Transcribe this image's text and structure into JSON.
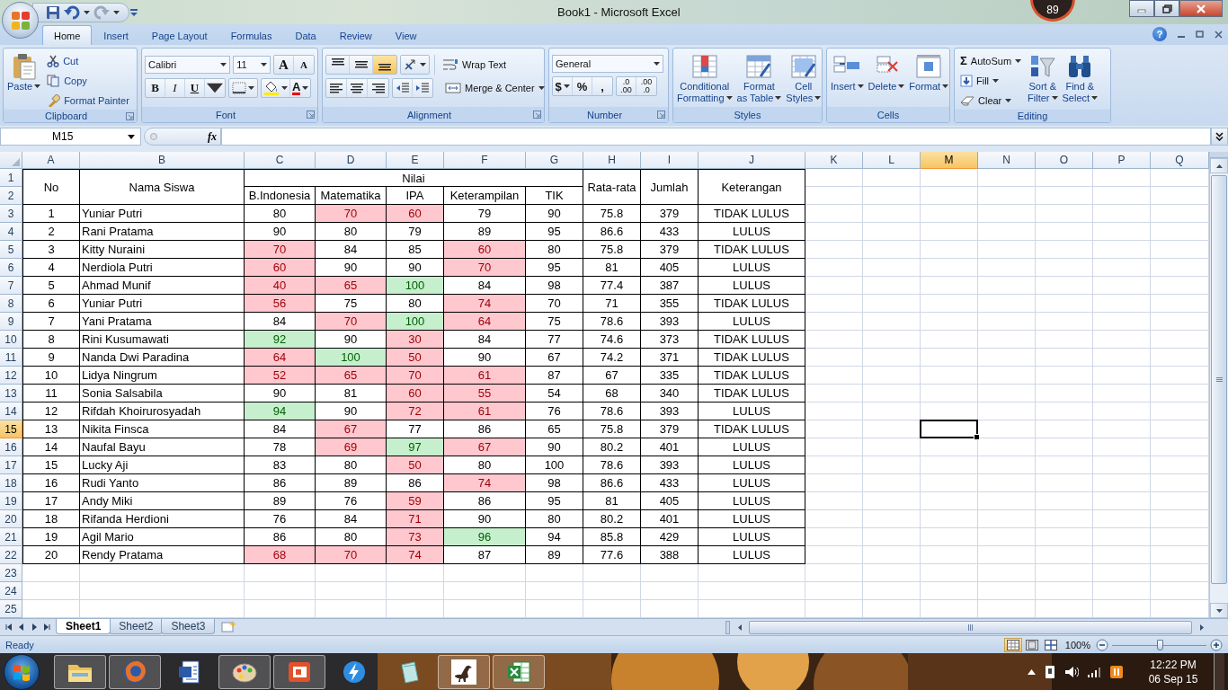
{
  "window": {
    "title": "Book1 - Microsoft Excel",
    "gadget_reading": "89",
    "help": "?"
  },
  "ribbon": {
    "tabs": [
      {
        "label": "Home",
        "selected": true
      },
      {
        "label": "Insert",
        "selected": false
      },
      {
        "label": "Page Layout",
        "selected": false
      },
      {
        "label": "Formulas",
        "selected": false
      },
      {
        "label": "Data",
        "selected": false
      },
      {
        "label": "Review",
        "selected": false
      },
      {
        "label": "View",
        "selected": false
      }
    ],
    "clipboard": {
      "title": "Clipboard",
      "paste": "Paste",
      "cut": "Cut",
      "copy": "Copy",
      "format_painter": "Format Painter"
    },
    "font": {
      "title": "Font",
      "font_name": "Calibri",
      "font_size": "11",
      "grow": "A",
      "shrink": "A",
      "bold": "B",
      "italic": "I",
      "underline": "U",
      "font_color": "A"
    },
    "alignment": {
      "title": "Alignment",
      "vertical": [
        {
          "kind": "top",
          "selected": false
        },
        {
          "kind": "middle",
          "selected": false
        },
        {
          "kind": "bottom",
          "selected": true
        }
      ],
      "horizontal": [
        {
          "kind": "left",
          "selected": false
        },
        {
          "kind": "center",
          "selected": false
        },
        {
          "kind": "right",
          "selected": false
        }
      ],
      "wrap_text": "Wrap Text",
      "merge": "Merge & Center"
    },
    "number": {
      "title": "Number",
      "format": "General",
      "currency": "$",
      "percent": "%",
      "comma": ",",
      "increase_decimal": [
        ".0",
        ".00"
      ],
      "decrease_decimal": [
        ".00",
        ".0"
      ]
    },
    "styles": {
      "title": "Styles",
      "conditional": [
        "Conditional",
        "Formatting"
      ],
      "as_table": [
        "Format",
        "as Table"
      ],
      "cell_styles": [
        "Cell",
        "Styles"
      ]
    },
    "cells": {
      "title": "Cells",
      "insert": "Insert",
      "delete": "Delete",
      "format": "Format"
    },
    "editing": {
      "title": "Editing",
      "autosum_symbol": "Σ",
      "autosum": "AutoSum",
      "fill": "Fill",
      "clear": "Clear",
      "sort": [
        "Sort &",
        "Filter"
      ],
      "find": [
        "Find &",
        "Select"
      ]
    }
  },
  "formula_bar": {
    "name_box": "M15",
    "fx": "fx"
  },
  "sheet": {
    "column_headers": [
      {
        "label": "A",
        "selected": false
      },
      {
        "label": "B",
        "selected": false
      },
      {
        "label": "C",
        "selected": false
      },
      {
        "label": "D",
        "selected": false
      },
      {
        "label": "E",
        "selected": false
      },
      {
        "label": "F",
        "selected": false
      },
      {
        "label": "G",
        "selected": false
      },
      {
        "label": "H",
        "selected": false
      },
      {
        "label": "I",
        "selected": false
      },
      {
        "label": "J",
        "selected": false
      },
      {
        "label": "K",
        "selected": false
      },
      {
        "label": "L",
        "selected": false
      },
      {
        "label": "M",
        "selected": true
      },
      {
        "label": "N",
        "selected": false
      },
      {
        "label": "O",
        "selected": false
      },
      {
        "label": "P",
        "selected": false
      },
      {
        "label": "Q",
        "selected": false
      }
    ],
    "row_headers": [
      {
        "label": "1",
        "selected": false
      },
      {
        "label": "2",
        "selected": false
      },
      {
        "label": "3",
        "selected": false
      },
      {
        "label": "4",
        "selected": false
      },
      {
        "label": "5",
        "selected": false
      },
      {
        "label": "6",
        "selected": false
      },
      {
        "label": "7",
        "selected": false
      },
      {
        "label": "8",
        "selected": false
      },
      {
        "label": "9",
        "selected": false
      },
      {
        "label": "10",
        "selected": false
      },
      {
        "label": "11",
        "selected": false
      },
      {
        "label": "12",
        "selected": false
      },
      {
        "label": "13",
        "selected": false
      },
      {
        "label": "14",
        "selected": false
      },
      {
        "label": "15",
        "selected": true
      },
      {
        "label": "16",
        "selected": false
      },
      {
        "label": "17",
        "selected": false
      },
      {
        "label": "18",
        "selected": false
      },
      {
        "label": "19",
        "selected": false
      },
      {
        "label": "20",
        "selected": false
      },
      {
        "label": "21",
        "selected": false
      },
      {
        "label": "22",
        "selected": false
      },
      {
        "label": "23",
        "selected": false
      },
      {
        "label": "24",
        "selected": false
      },
      {
        "label": "25",
        "selected": false
      }
    ],
    "table": {
      "no": "No",
      "name": "Nama Siswa",
      "group": "Nilai",
      "subjects": [
        "B.Indonesia",
        "Matematika",
        "IPA",
        "Keterampilan",
        "TIK"
      ],
      "average": "Rata-rata",
      "total": "Jumlah",
      "result": "Keterangan"
    },
    "rows": [
      {
        "no": "1",
        "name": "Yuniar Putri",
        "scores": [
          {
            "value": "80",
            "color": "#ffffff"
          },
          {
            "value": "70",
            "color": "#ffc7ce"
          },
          {
            "value": "60",
            "color": "#ffc7ce"
          },
          {
            "value": "79",
            "color": "#ffffff"
          },
          {
            "value": "90",
            "color": "#ffffff"
          }
        ],
        "average": "75.8",
        "total": "379",
        "result": "TIDAK LULUS"
      },
      {
        "no": "2",
        "name": "Rani Pratama",
        "scores": [
          {
            "value": "90",
            "color": "#ffffff"
          },
          {
            "value": "80",
            "color": "#ffffff"
          },
          {
            "value": "79",
            "color": "#ffffff"
          },
          {
            "value": "89",
            "color": "#ffffff"
          },
          {
            "value": "95",
            "color": "#ffffff"
          }
        ],
        "average": "86.6",
        "total": "433",
        "result": "LULUS"
      },
      {
        "no": "3",
        "name": "Kitty Nuraini",
        "scores": [
          {
            "value": "70",
            "color": "#ffc7ce"
          },
          {
            "value": "84",
            "color": "#ffffff"
          },
          {
            "value": "85",
            "color": "#ffffff"
          },
          {
            "value": "60",
            "color": "#ffc7ce"
          },
          {
            "value": "80",
            "color": "#ffffff"
          }
        ],
        "average": "75.8",
        "total": "379",
        "result": "TIDAK LULUS"
      },
      {
        "no": "4",
        "name": "Nerdiola Putri",
        "scores": [
          {
            "value": "60",
            "color": "#ffc7ce"
          },
          {
            "value": "90",
            "color": "#ffffff"
          },
          {
            "value": "90",
            "color": "#ffffff"
          },
          {
            "value": "70",
            "color": "#ffc7ce"
          },
          {
            "value": "95",
            "color": "#ffffff"
          }
        ],
        "average": "81",
        "total": "405",
        "result": "LULUS"
      },
      {
        "no": "5",
        "name": "Ahmad Munif",
        "scores": [
          {
            "value": "40",
            "color": "#ffc7ce"
          },
          {
            "value": "65",
            "color": "#ffc7ce"
          },
          {
            "value": "100",
            "color": "#c6efce"
          },
          {
            "value": "84",
            "color": "#ffffff"
          },
          {
            "value": "98",
            "color": "#ffffff"
          }
        ],
        "average": "77.4",
        "total": "387",
        "result": "LULUS"
      },
      {
        "no": "6",
        "name": "Yuniar Putri",
        "scores": [
          {
            "value": "56",
            "color": "#ffc7ce"
          },
          {
            "value": "75",
            "color": "#ffffff"
          },
          {
            "value": "80",
            "color": "#ffffff"
          },
          {
            "value": "74",
            "color": "#ffc7ce"
          },
          {
            "value": "70",
            "color": "#ffffff"
          }
        ],
        "average": "71",
        "total": "355",
        "result": "TIDAK LULUS"
      },
      {
        "no": "7",
        "name": "Yani Pratama",
        "scores": [
          {
            "value": "84",
            "color": "#ffffff"
          },
          {
            "value": "70",
            "color": "#ffc7ce"
          },
          {
            "value": "100",
            "color": "#c6efce"
          },
          {
            "value": "64",
            "color": "#ffc7ce"
          },
          {
            "value": "75",
            "color": "#ffffff"
          }
        ],
        "average": "78.6",
        "total": "393",
        "result": "LULUS"
      },
      {
        "no": "8",
        "name": "Rini Kusumawati",
        "scores": [
          {
            "value": "92",
            "color": "#c6efce"
          },
          {
            "value": "90",
            "color": "#ffffff"
          },
          {
            "value": "30",
            "color": "#ffc7ce"
          },
          {
            "value": "84",
            "color": "#ffffff"
          },
          {
            "value": "77",
            "color": "#ffffff"
          }
        ],
        "average": "74.6",
        "total": "373",
        "result": "TIDAK LULUS"
      },
      {
        "no": "9",
        "name": "Nanda Dwi Paradina",
        "scores": [
          {
            "value": "64",
            "color": "#ffc7ce"
          },
          {
            "value": "100",
            "color": "#c6efce"
          },
          {
            "value": "50",
            "color": "#ffc7ce"
          },
          {
            "value": "90",
            "color": "#ffffff"
          },
          {
            "value": "67",
            "color": "#ffffff"
          }
        ],
        "average": "74.2",
        "total": "371",
        "result": "TIDAK LULUS"
      },
      {
        "no": "10",
        "name": "Lidya Ningrum",
        "scores": [
          {
            "value": "52",
            "color": "#ffc7ce"
          },
          {
            "value": "65",
            "color": "#ffc7ce"
          },
          {
            "value": "70",
            "color": "#ffc7ce"
          },
          {
            "value": "61",
            "color": "#ffc7ce"
          },
          {
            "value": "87",
            "color": "#ffffff"
          }
        ],
        "average": "67",
        "total": "335",
        "result": "TIDAK LULUS"
      },
      {
        "no": "11",
        "name": "Sonia Salsabila",
        "scores": [
          {
            "value": "90",
            "color": "#ffffff"
          },
          {
            "value": "81",
            "color": "#ffffff"
          },
          {
            "value": "60",
            "color": "#ffc7ce"
          },
          {
            "value": "55",
            "color": "#ffc7ce"
          },
          {
            "value": "54",
            "color": "#ffffff"
          }
        ],
        "average": "68",
        "total": "340",
        "result": "TIDAK LULUS"
      },
      {
        "no": "12",
        "name": "Rifdah Khoirurosyadah",
        "scores": [
          {
            "value": "94",
            "color": "#c6efce"
          },
          {
            "value": "90",
            "color": "#ffffff"
          },
          {
            "value": "72",
            "color": "#ffc7ce"
          },
          {
            "value": "61",
            "color": "#ffc7ce"
          },
          {
            "value": "76",
            "color": "#ffffff"
          }
        ],
        "average": "78.6",
        "total": "393",
        "result": "LULUS"
      },
      {
        "no": "13",
        "name": "Nikita Finsca",
        "scores": [
          {
            "value": "84",
            "color": "#ffffff"
          },
          {
            "value": "67",
            "color": "#ffc7ce"
          },
          {
            "value": "77",
            "color": "#ffffff"
          },
          {
            "value": "86",
            "color": "#ffffff"
          },
          {
            "value": "65",
            "color": "#ffffff"
          }
        ],
        "average": "75.8",
        "total": "379",
        "result": "TIDAK LULUS"
      },
      {
        "no": "14",
        "name": "Naufal Bayu",
        "scores": [
          {
            "value": "78",
            "color": "#ffffff"
          },
          {
            "value": "69",
            "color": "#ffc7ce"
          },
          {
            "value": "97",
            "color": "#c6efce"
          },
          {
            "value": "67",
            "color": "#ffc7ce"
          },
          {
            "value": "90",
            "color": "#ffffff"
          }
        ],
        "average": "80.2",
        "total": "401",
        "result": "LULUS"
      },
      {
        "no": "15",
        "name": "Lucky Aji",
        "scores": [
          {
            "value": "83",
            "color": "#ffffff"
          },
          {
            "value": "80",
            "color": "#ffffff"
          },
          {
            "value": "50",
            "color": "#ffc7ce"
          },
          {
            "value": "80",
            "color": "#ffffff"
          },
          {
            "value": "100",
            "color": "#ffffff"
          }
        ],
        "average": "78.6",
        "total": "393",
        "result": "LULUS"
      },
      {
        "no": "16",
        "name": "Rudi Yanto",
        "scores": [
          {
            "value": "86",
            "color": "#ffffff"
          },
          {
            "value": "89",
            "color": "#ffffff"
          },
          {
            "value": "86",
            "color": "#ffffff"
          },
          {
            "value": "74",
            "color": "#ffc7ce"
          },
          {
            "value": "98",
            "color": "#ffffff"
          }
        ],
        "average": "86.6",
        "total": "433",
        "result": "LULUS"
      },
      {
        "no": "17",
        "name": "Andy Miki",
        "scores": [
          {
            "value": "89",
            "color": "#ffffff"
          },
          {
            "value": "76",
            "color": "#ffffff"
          },
          {
            "value": "59",
            "color": "#ffc7ce"
          },
          {
            "value": "86",
            "color": "#ffffff"
          },
          {
            "value": "95",
            "color": "#ffffff"
          }
        ],
        "average": "81",
        "total": "405",
        "result": "LULUS"
      },
      {
        "no": "18",
        "name": "Rifanda Herdioni",
        "scores": [
          {
            "value": "76",
            "color": "#ffffff"
          },
          {
            "value": "84",
            "color": "#ffffff"
          },
          {
            "value": "71",
            "color": "#ffc7ce"
          },
          {
            "value": "90",
            "color": "#ffffff"
          },
          {
            "value": "80",
            "color": "#ffffff"
          }
        ],
        "average": "80.2",
        "total": "401",
        "result": "LULUS"
      },
      {
        "no": "19",
        "name": "Agil Mario",
        "scores": [
          {
            "value": "86",
            "color": "#ffffff"
          },
          {
            "value": "80",
            "color": "#ffffff"
          },
          {
            "value": "73",
            "color": "#ffc7ce"
          },
          {
            "value": "96",
            "color": "#c6efce"
          },
          {
            "value": "94",
            "color": "#ffffff"
          }
        ],
        "average": "85.8",
        "total": "429",
        "result": "LULUS"
      },
      {
        "no": "20",
        "name": "Rendy Pratama",
        "scores": [
          {
            "value": "68",
            "color": "#ffc7ce"
          },
          {
            "value": "70",
            "color": "#ffc7ce"
          },
          {
            "value": "74",
            "color": "#ffc7ce"
          },
          {
            "value": "87",
            "color": "#ffffff"
          },
          {
            "value": "89",
            "color": "#ffffff"
          }
        ],
        "average": "77.6",
        "total": "388",
        "result": "LULUS"
      }
    ]
  },
  "sheet_tabs": [
    {
      "label": "Sheet1",
      "selected": true
    },
    {
      "label": "Sheet2",
      "selected": false
    },
    {
      "label": "Sheet3",
      "selected": false
    }
  ],
  "status_bar": {
    "status": "Ready",
    "views": [
      {
        "kind": "normal",
        "selected": true
      },
      {
        "kind": "page_layout",
        "selected": false
      },
      {
        "kind": "page_break",
        "selected": false
      }
    ],
    "zoom": "100%",
    "zoom_slider": {
      "level": 0.5
    }
  },
  "taskbar": {
    "apps": [
      {
        "kind": "folder",
        "running": true
      },
      {
        "kind": "browser",
        "running": true
      },
      {
        "kind": "document",
        "running": false
      },
      {
        "kind": "paint",
        "running": true
      },
      {
        "kind": "presentation",
        "running": true
      },
      {
        "kind": "bolt",
        "running": false
      },
      {
        "kind": "notes",
        "running": false
      },
      {
        "kind": "dinosaur",
        "running": true
      },
      {
        "kind": "spreadsheet",
        "running": true
      }
    ],
    "time": "12:22 PM",
    "date": "06 Sep 15"
  }
}
